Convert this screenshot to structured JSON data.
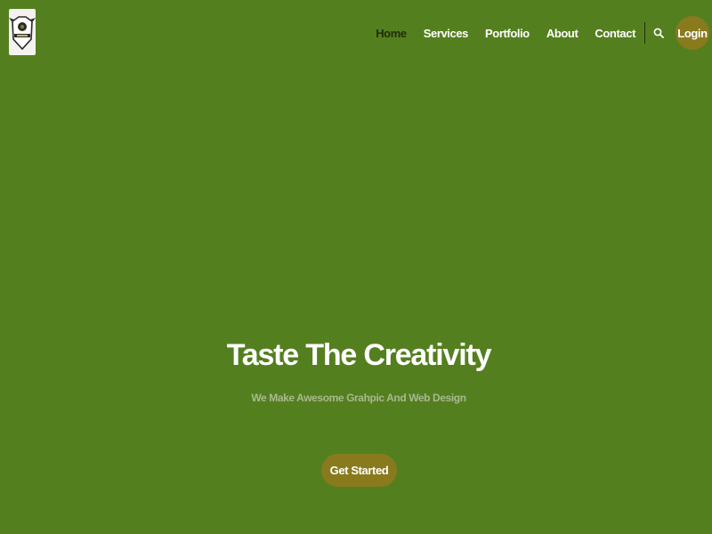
{
  "header": {
    "logo_icon": "shield-crest-logo",
    "nav_items": [
      {
        "label": "Home",
        "active": true
      },
      {
        "label": "Services",
        "active": false
      },
      {
        "label": "Portfolio",
        "active": false
      },
      {
        "label": "About",
        "active": false
      },
      {
        "label": "Contact",
        "active": false
      }
    ],
    "search_icon": "search-icon",
    "login_label": "Login"
  },
  "hero": {
    "title": "Taste The Creativity",
    "subtitle": "We Make Awesome Grahpic And Web Design",
    "cta_label": "Get Started"
  },
  "colors": {
    "background": "#547f1f",
    "accent": "#8a7a1e",
    "active_nav": "#1e2e08",
    "subtitle": "#a7b98f"
  }
}
